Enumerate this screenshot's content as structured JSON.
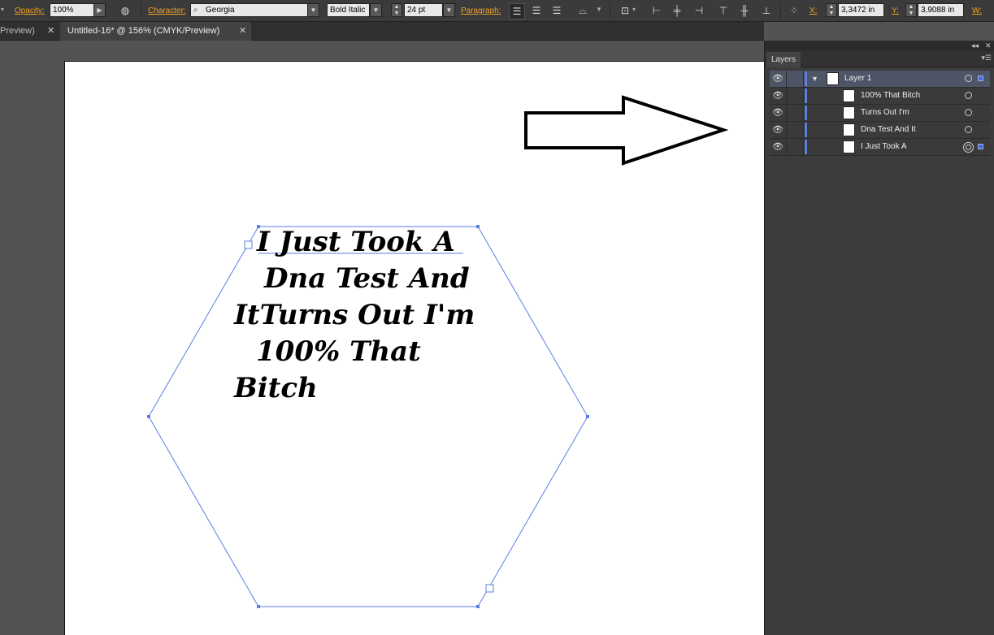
{
  "control_bar": {
    "opacity_label": "Opacity:",
    "opacity_value": "100%",
    "character_label": "Character:",
    "font_family": "Georgia",
    "font_style": "Bold Italic",
    "font_size": "24 pt",
    "paragraph_label": "Paragraph:",
    "x_label": "X:",
    "x_value": "3,3472 in",
    "y_label": "Y:",
    "y_value": "3,9088 in",
    "w_label": "W:"
  },
  "tabs": [
    {
      "label": "Preview)"
    },
    {
      "label": "Untitled-16* @ 156% (CMYK/Preview)"
    }
  ],
  "canvas": {
    "text_lines": [
      "I Just Took A",
      "Dna Test And",
      "ItTurns Out I'm",
      "100% That",
      "Bitch"
    ]
  },
  "layers_panel": {
    "title": "Layers",
    "layers": [
      {
        "name": "Layer 1"
      },
      {
        "name": "100% That Bitch"
      },
      {
        "name": "Turns Out I'm"
      },
      {
        "name": "Dna Test And It"
      },
      {
        "name": "I Just Took A"
      }
    ]
  },
  "colors": {
    "accent_label": "#f0a020",
    "selection": "#5b7ee0"
  }
}
